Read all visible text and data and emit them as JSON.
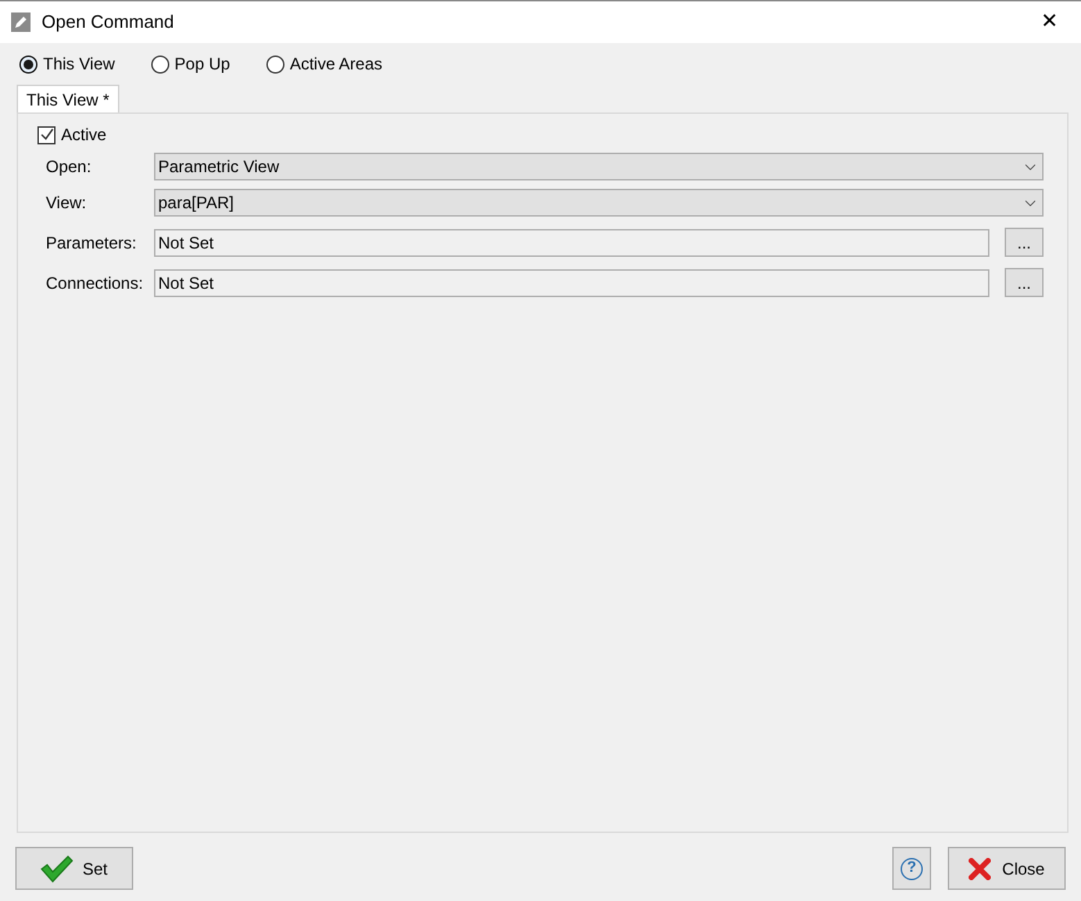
{
  "window": {
    "title": "Open Command",
    "close_label": "✕"
  },
  "modes": [
    {
      "label": "This View",
      "selected": true
    },
    {
      "label": "Pop Up",
      "selected": false
    },
    {
      "label": "Active Areas",
      "selected": false
    }
  ],
  "tabs": [
    {
      "label": "This View *",
      "selected": true
    }
  ],
  "active": {
    "label": "Active",
    "checked": true
  },
  "fields": [
    {
      "label": "Open:",
      "kind": "select",
      "value": "Parametric View"
    },
    {
      "label": "View:",
      "kind": "select",
      "value": "para[PAR]"
    },
    {
      "label": "Parameters:",
      "kind": "text",
      "value": "Not Set",
      "button": "..."
    },
    {
      "label": "Connections:",
      "kind": "text",
      "value": "Not Set",
      "button": "..."
    }
  ],
  "buttons": {
    "set": "Set",
    "help": "?",
    "close": "Close"
  }
}
